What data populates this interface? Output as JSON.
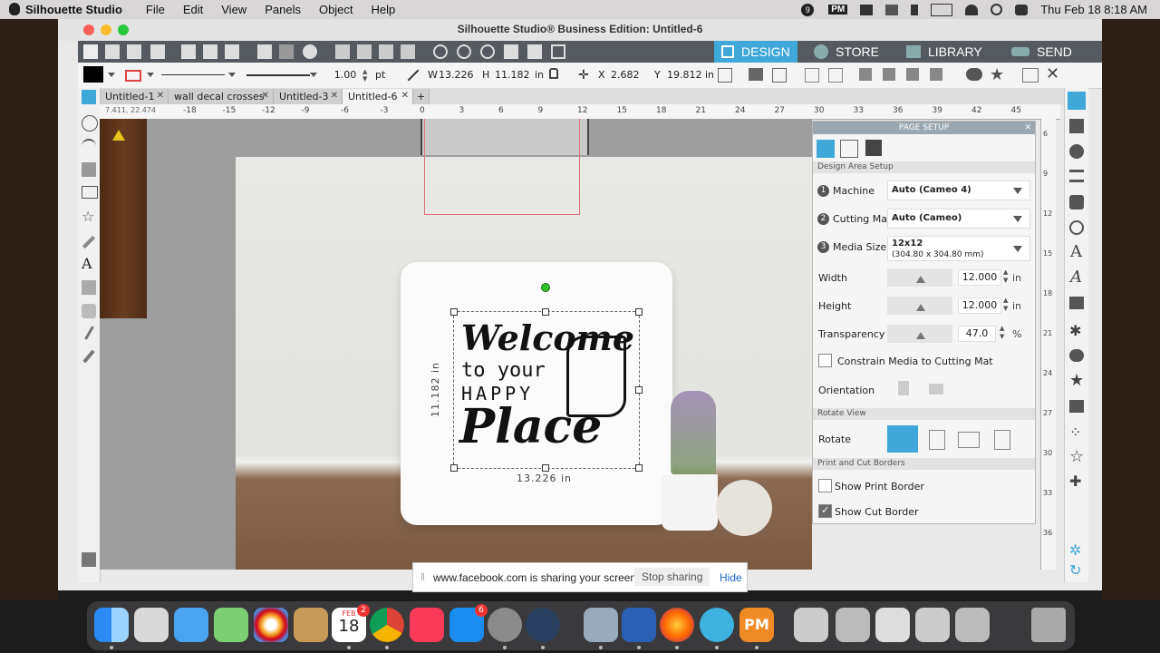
{
  "menubar": {
    "apple": "",
    "app": "Silhouette Studio",
    "items": [
      "File",
      "Edit",
      "View",
      "Panels",
      "Object",
      "Help"
    ],
    "clock": "Thu Feb 18  8:18 AM",
    "badge_9": "9",
    "pm": "PM"
  },
  "window": {
    "title": "Silhouette Studio® Business Edition: Untitled-6",
    "nav_tabs": [
      "DESIGN",
      "STORE",
      "LIBRARY",
      "SEND"
    ]
  },
  "toolbar2": {
    "line_width": "1.00",
    "line_unit": "pt",
    "w_label": "W",
    "w_value": "13.226",
    "h_label": "H",
    "h_value": "11.182",
    "in_unit": "in",
    "x_label": "X",
    "x_value": "2.682",
    "y_label": "Y",
    "y_value": "19.812"
  },
  "doc_tabs": [
    {
      "label": "Untitled-1"
    },
    {
      "label": "wall decal crosses"
    },
    {
      "label": "Untitled-3"
    },
    {
      "label": "Untitled-6"
    }
  ],
  "ruler": {
    "coords": "7.411, 22.474",
    "h_ticks": [
      "-18",
      "-15",
      "-12",
      "-9",
      "-6",
      "-3",
      "0",
      "3",
      "6",
      "9",
      "12",
      "15",
      "18",
      "21",
      "24",
      "27",
      "30",
      "33",
      "36",
      "39",
      "42",
      "45"
    ],
    "v_ticks": [
      "6",
      "9",
      "12",
      "15",
      "18",
      "21",
      "24",
      "27",
      "30",
      "33",
      "36"
    ]
  },
  "design": {
    "line1": "Welcome",
    "line2": "to your",
    "line3": "HAPPY",
    "line4": "Place",
    "width_dim": "13.226 in",
    "height_dim": "11.182 in"
  },
  "page_setup": {
    "title": "PAGE SETUP",
    "section_design_area": "Design Area Setup",
    "machine_label": "Machine",
    "machine_value": "Auto (Cameo 4)",
    "cutting_mat_label": "Cutting Mat",
    "cutting_mat_value": "Auto (Cameo)",
    "media_size_label": "Media Size",
    "media_size_value": "12x12",
    "media_size_sub": "(304.80 x 304.80 mm)",
    "width_label": "Width",
    "width_value": "12.000",
    "height_label": "Height",
    "height_value": "12.000",
    "transparency_label": "Transparency",
    "transparency_value": "47.0",
    "percent": "%",
    "in": "in",
    "constrain_label": "Constrain Media to Cutting Mat",
    "orientation_label": "Orientation",
    "section_rotate": "Rotate View",
    "rotate_label": "Rotate",
    "section_borders": "Print and Cut Borders",
    "show_print_border": "Show Print Border",
    "show_cut_border": "Show Cut Border",
    "step1": "1",
    "step2": "2",
    "step3": "3"
  },
  "notification": {
    "message": "www.facebook.com is sharing your screen.",
    "stop": "Stop sharing",
    "hide": "Hide"
  },
  "dock": {
    "calendar_month": "FEB",
    "calendar_day": "18",
    "calendar_badge": "2",
    "appstore_badge": "6",
    "pm_label": "PM"
  },
  "colors": {
    "design_tab": "#3fa8d8",
    "toolbar_dark": "#555a60",
    "accent": "#2a9fd6"
  }
}
